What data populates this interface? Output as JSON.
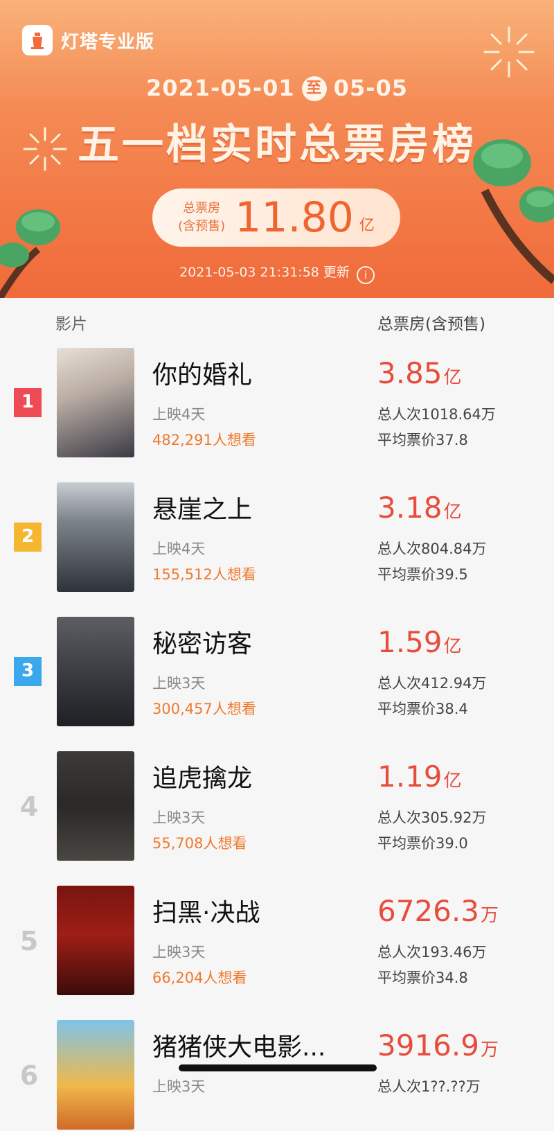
{
  "brand": {
    "name": "灯塔专业版",
    "icon": "lighthouse-icon"
  },
  "banner": {
    "date_start": "2021-05-01",
    "date_sep": "至",
    "date_end": "05-05",
    "title": "五一档实时总票房榜",
    "total_label_line1": "总票房",
    "total_label_line2": "(含预售)",
    "total_value": "11.80",
    "total_unit": "亿",
    "updated": "2021-05-03 21:31:58 更新",
    "info_icon": "info-icon"
  },
  "table": {
    "col_film": "影片",
    "col_box": "总票房(含预售)",
    "movies": [
      {
        "rank": "1",
        "name": "你的婚礼",
        "days": "上映4天",
        "wish": "482,291人想看",
        "box": "3.85",
        "unit": "亿",
        "viewers": "总人次1018.64万",
        "avg": "平均票价37.8"
      },
      {
        "rank": "2",
        "name": "悬崖之上",
        "days": "上映4天",
        "wish": "155,512人想看",
        "box": "3.18",
        "unit": "亿",
        "viewers": "总人次804.84万",
        "avg": "平均票价39.5"
      },
      {
        "rank": "3",
        "name": "秘密访客",
        "days": "上映3天",
        "wish": "300,457人想看",
        "box": "1.59",
        "unit": "亿",
        "viewers": "总人次412.94万",
        "avg": "平均票价38.4"
      },
      {
        "rank": "4",
        "name": "追虎擒龙",
        "days": "上映3天",
        "wish": "55,708人想看",
        "box": "1.19",
        "unit": "亿",
        "viewers": "总人次305.92万",
        "avg": "平均票价39.0"
      },
      {
        "rank": "5",
        "name": "扫黑·决战",
        "days": "上映3天",
        "wish": "66,204人想看",
        "box": "6726.3",
        "unit": "万",
        "viewers": "总人次193.46万",
        "avg": "平均票价34.8"
      },
      {
        "rank": "6",
        "name": "猪猪侠大电影...",
        "days": "上映3天",
        "wish": "",
        "box": "3916.9",
        "unit": "万",
        "viewers": "总人次1??.??万",
        "avg": ""
      }
    ]
  },
  "colors": {
    "rank1": "#ef4b57",
    "rank2": "#f5b731",
    "rank3": "#3aa8ea",
    "box": "#e74c3c",
    "wish": "#ef7a2d"
  }
}
